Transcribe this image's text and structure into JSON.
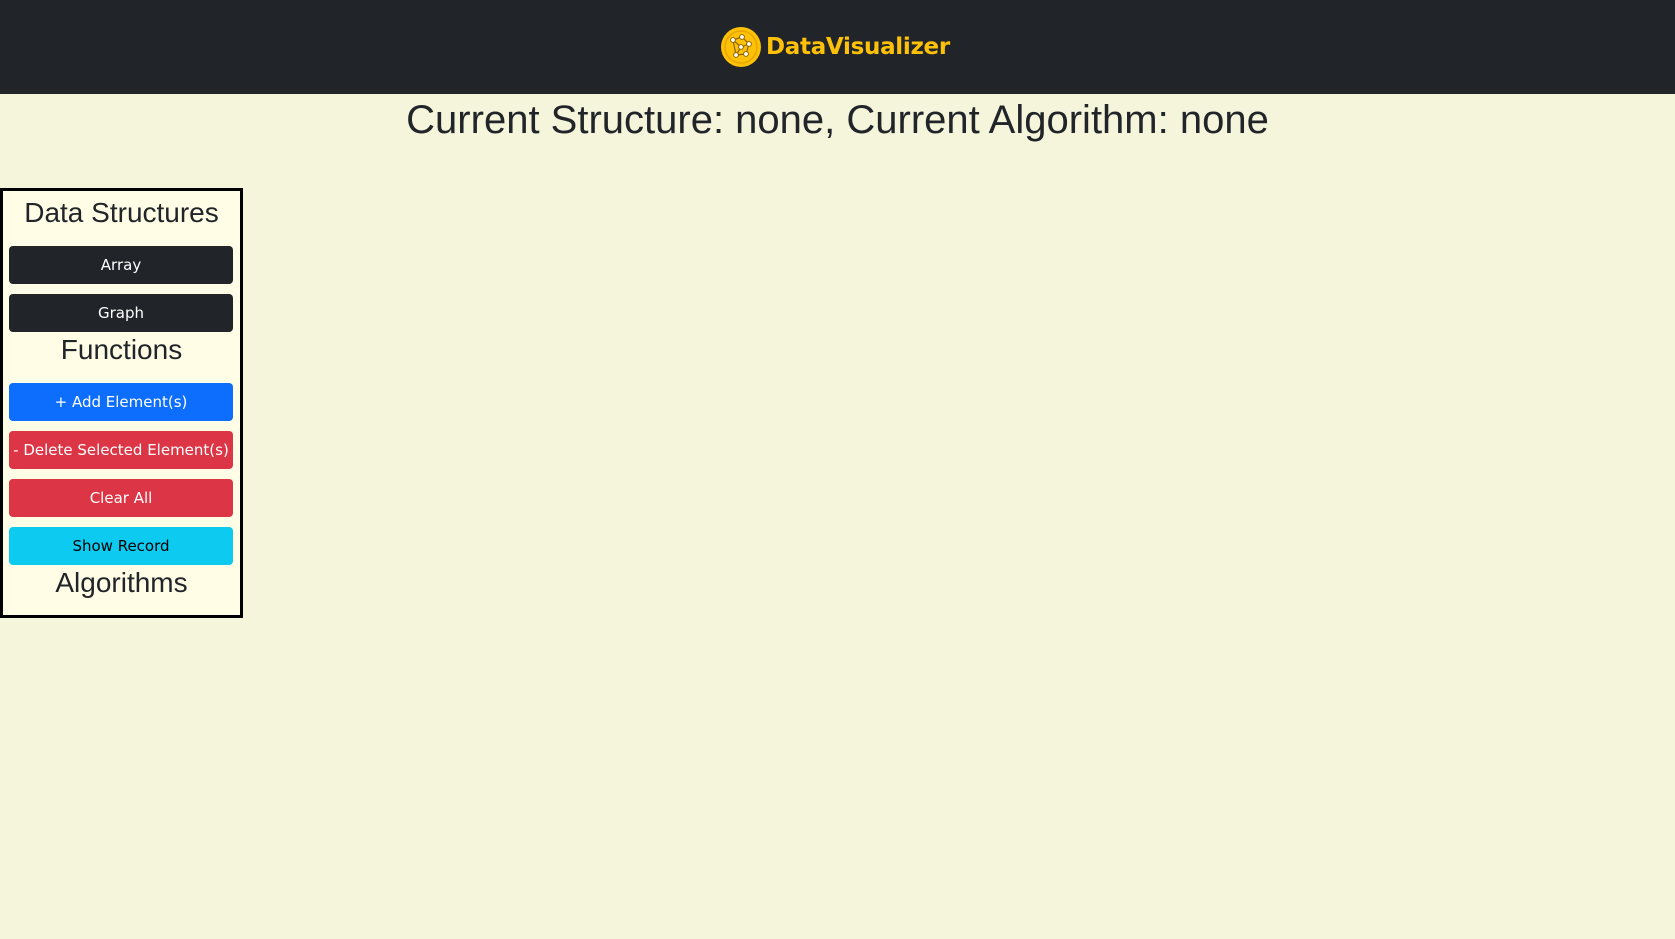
{
  "navbar": {
    "brand_name": "DataVisualizer",
    "logo_icon": "network-graph-logo",
    "background_color": "#212529",
    "brand_color": "#ffc107"
  },
  "main": {
    "status_heading": "Current Structure: none, Current Algorithm: none",
    "background_color": "#f5f5dc"
  },
  "sidebar": {
    "data_structures": {
      "title": "Data Structures",
      "buttons": [
        "Array",
        "Graph"
      ]
    },
    "functions": {
      "title": "Functions",
      "add_label": "+ Add Element(s)",
      "delete_label": "- Delete Selected Element(s)",
      "clear_label": "Clear All",
      "record_label": "Show Record"
    },
    "algorithms": {
      "title": "Algorithms"
    }
  },
  "colors": {
    "primary": "#0d6efd",
    "danger": "#dc3545",
    "info": "#0dcaf0",
    "dark": "#212529"
  }
}
